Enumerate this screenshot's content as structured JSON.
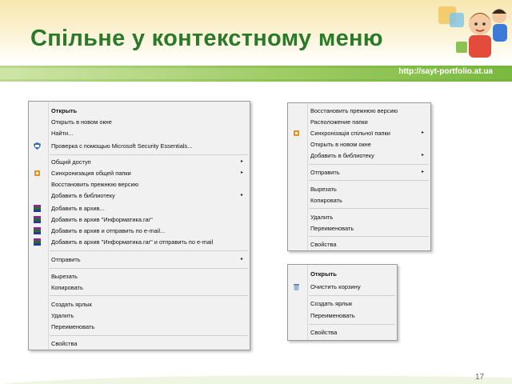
{
  "slide": {
    "title": "Спільне у контекстному меню",
    "url": "http://sayt-portfolio.at.ua",
    "page_number": "17"
  },
  "menu_big": {
    "items": [
      {
        "label": "Открыть",
        "bold": true
      },
      {
        "label": "Открыть в новом окне"
      },
      {
        "label": "Найти..."
      },
      {
        "label": "Проверка с помощью Microsoft Security Essentials...",
        "icon": "security-essentials-icon"
      },
      {
        "label": "Общий доступ",
        "arrow": "▸"
      },
      {
        "label": "Синхронизация общей папки",
        "arrow": "▸",
        "icon": "sync-icon"
      },
      {
        "label": "Восстановить прежнюю версию"
      },
      {
        "label": "Добавить в библиотеку",
        "arrow": "▸"
      },
      {
        "label": "Добавить в архив...",
        "icon": "winrar-icon"
      },
      {
        "label": "Добавить в архив \"Информатика.rar\"",
        "icon": "winrar-icon"
      },
      {
        "label": "Добавить в архив и отправить по e-mail...",
        "icon": "winrar-icon"
      },
      {
        "label": "Добавить в архив \"Информатика.rar\" и отправить по e-mail",
        "icon": "winrar-icon"
      },
      {
        "label": "Отправить",
        "arrow": "▸"
      },
      {
        "label": "Вырезать"
      },
      {
        "label": "Копировать"
      },
      {
        "label": "Создать ярлык"
      },
      {
        "label": "Удалить"
      },
      {
        "label": "Переименовать"
      },
      {
        "label": "Свойства"
      }
    ]
  },
  "menu_top_right": {
    "items": [
      {
        "label": "Восстановить прежнюю версию"
      },
      {
        "label": "Расположение папки"
      },
      {
        "label": "Синхронізація спільної папки",
        "arrow": "▸",
        "icon": "sync-icon"
      },
      {
        "label": "Открыть в новом окне"
      },
      {
        "label": "Добавить в библиотеку",
        "arrow": "▸"
      },
      {
        "label": "Отправить",
        "arrow": "▸"
      },
      {
        "label": "Вырезать"
      },
      {
        "label": "Копировать"
      },
      {
        "label": "Удалить"
      },
      {
        "label": "Переименовать"
      },
      {
        "label": "Свойства"
      }
    ]
  },
  "menu_bottom_right": {
    "items": [
      {
        "label": "Открыть",
        "bold": true
      },
      {
        "label": "Очистить корзину",
        "icon": "recycle-bin-icon"
      },
      {
        "label": "Создать ярлык"
      },
      {
        "label": "Переименовать"
      },
      {
        "label": "Свойства"
      }
    ]
  }
}
